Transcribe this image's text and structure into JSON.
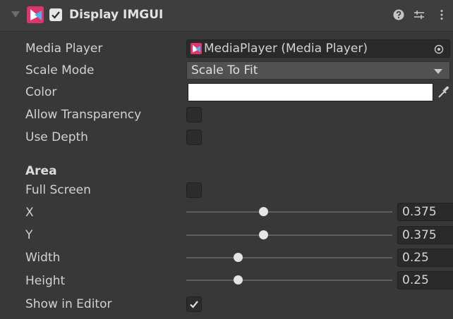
{
  "header": {
    "title": "Display IMGUI",
    "enabled": true,
    "icons": [
      "foldout-arrow-icon",
      "avpro-logo-icon",
      "help-icon",
      "presets-icon",
      "kebab-menu-icon"
    ]
  },
  "fields": {
    "media_player": {
      "label": "Media Player",
      "value": "MediaPlayer (Media Player)"
    },
    "scale_mode": {
      "label": "Scale Mode",
      "value": "Scale To Fit"
    },
    "color": {
      "label": "Color",
      "value": "#ffffff"
    },
    "allow_transparency": {
      "label": "Allow Transparency",
      "checked": false
    },
    "use_depth": {
      "label": "Use Depth",
      "checked": false
    }
  },
  "area": {
    "heading": "Area",
    "full_screen": {
      "label": "Full Screen",
      "checked": false
    },
    "sliders": [
      {
        "label": "X",
        "value": "0.375",
        "fraction": 0.375
      },
      {
        "label": "Y",
        "value": "0.375",
        "fraction": 0.375
      },
      {
        "label": "Width",
        "value": "0.25",
        "fraction": 0.25
      },
      {
        "label": "Height",
        "value": "0.25",
        "fraction": 0.25
      }
    ],
    "show_in_editor": {
      "label": "Show in Editor",
      "checked": true
    }
  },
  "colors": {
    "background": "#383838",
    "header": "#3e3e3e",
    "accent": "#e0356b",
    "text": "#d2d2d2"
  }
}
